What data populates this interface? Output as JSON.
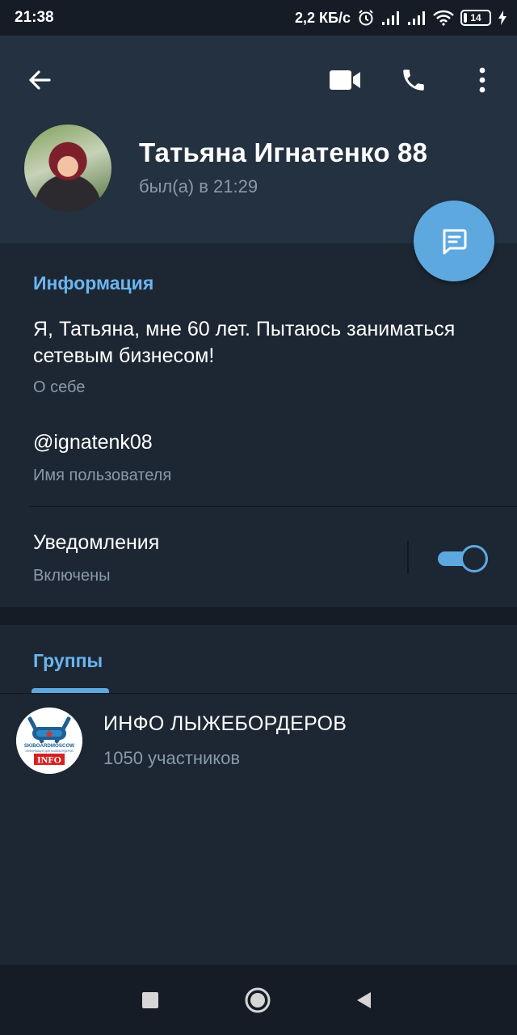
{
  "status_bar": {
    "time": "21:38",
    "network_speed": "2,2 КБ/с",
    "battery_level": "14",
    "icons": [
      "alarm-icon",
      "signal-icon",
      "signal-icon",
      "wifi-icon",
      "battery-icon",
      "charging-icon"
    ]
  },
  "toolbar": {
    "back_icon": "arrow-left-icon",
    "video_icon": "video-camera-icon",
    "call_icon": "phone-icon",
    "more_icon": "more-vertical-icon"
  },
  "profile": {
    "name": "Татьяна Игнатенко 88",
    "last_seen": "был(а) в 21:29"
  },
  "fab": {
    "icon": "message-icon"
  },
  "info": {
    "title": "Информация",
    "bio": "Я, Татьяна, мне 60 лет. Пытаюсь заниматься сетевым бизнесом!",
    "bio_label": "О себе",
    "username": "@ignatenk08",
    "username_label": "Имя пользователя",
    "notifications_title": "Уведомления",
    "notifications_status": "Включены",
    "notifications_enabled": true
  },
  "groups": {
    "tab_title": "Группы",
    "items": [
      {
        "name": "ИНФО ЛЫЖЕБОРДЕРОВ",
        "members": "1050 участников"
      }
    ],
    "logo_text": {
      "top": "SKIBOARDMOSCOW",
      "sub": "ИНФОРМАЦИЯ ДЛЯ ЛЫЖЕБОРДЕРОВ",
      "badge": "INFO"
    }
  },
  "nav_bar": {
    "icons": [
      "square-icon",
      "circle-home-icon",
      "triangle-back-icon"
    ]
  },
  "colors": {
    "background": "#1d2733",
    "header": "#243140",
    "accent": "#5ea8e0",
    "section_title": "#6bb5f0",
    "secondary_text": "#8a99a9"
  }
}
